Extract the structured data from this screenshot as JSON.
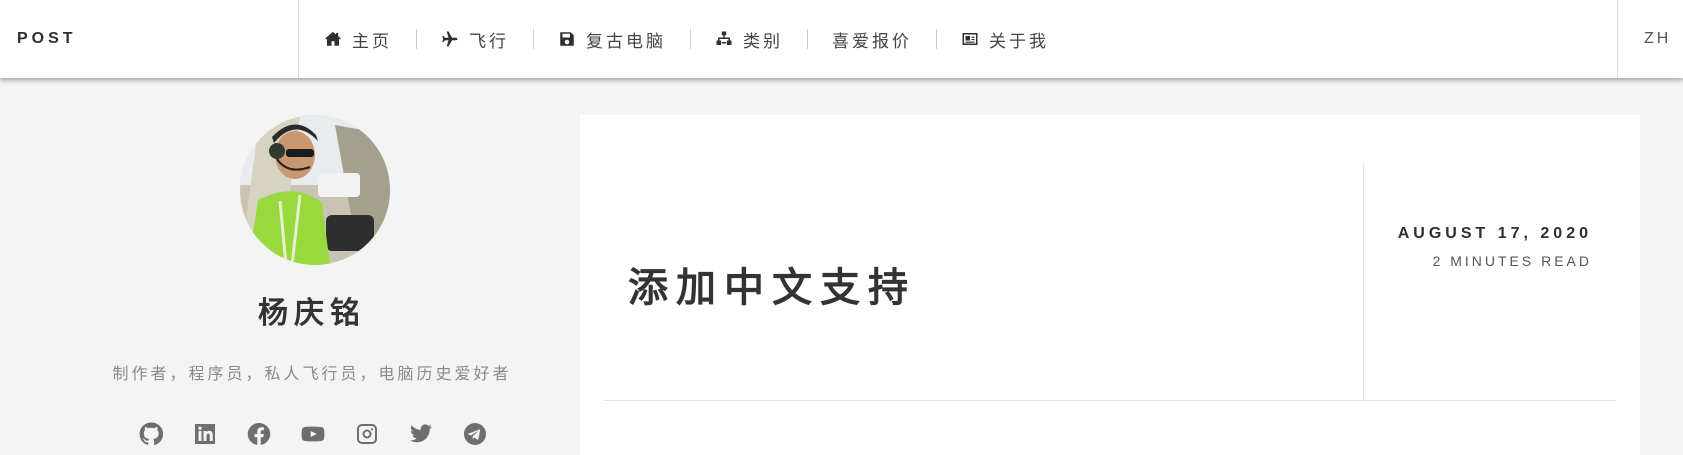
{
  "header": {
    "brand": "POST",
    "language": "ZH",
    "nav": [
      {
        "label": "主页",
        "icon": "home-icon"
      },
      {
        "label": "飞行",
        "icon": "plane-icon"
      },
      {
        "label": "复古电脑",
        "icon": "floppy-disk-icon"
      },
      {
        "label": "类别",
        "icon": "sitemap-icon"
      },
      {
        "label": "喜爱报价",
        "icon": ""
      },
      {
        "label": "关于我",
        "icon": "id-card-icon"
      }
    ]
  },
  "sidebar": {
    "author_name": "杨庆铭",
    "bio": "制作者，程序员，私人飞行员，电脑历史爱好者",
    "social_icons": [
      "github-icon",
      "linkedin-icon",
      "facebook-icon",
      "youtube-icon",
      "instagram-icon",
      "twitter-icon",
      "telegram-icon"
    ]
  },
  "post": {
    "title": "添加中文支持",
    "date": "AUGUST 17, 2020",
    "read_time": "2 MINUTES READ"
  },
  "colors": {
    "page_background": "#f4f4f4",
    "card_background": "#ffffff",
    "text_dark": "#333333",
    "text_muted": "#8a8a8a",
    "icon_gray": "#6e6e6e"
  }
}
